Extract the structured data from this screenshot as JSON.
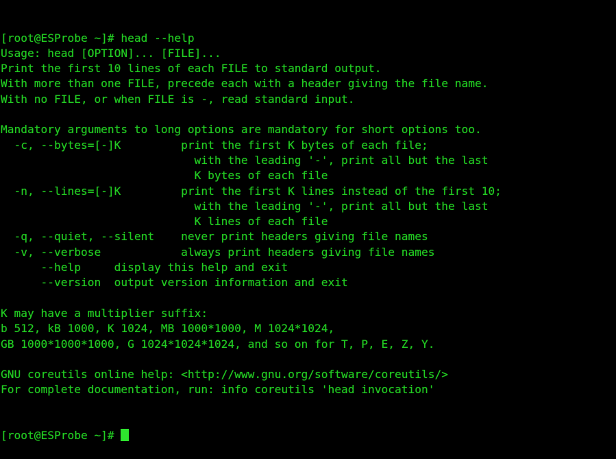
{
  "terminal": {
    "colors": {
      "background": "#000000",
      "foreground": "#22cc22",
      "cursor": "#2ee62e"
    },
    "hostname": "ESProbe",
    "user": "root",
    "cwd": "~",
    "prompt": "[root@ESProbe ~]# ",
    "command": "head --help",
    "cursor_glyph": "block"
  },
  "lines": [
    {
      "id": "prompt-command",
      "text": "[root@ESProbe ~]# head --help"
    },
    {
      "id": "usage",
      "text": "Usage: head [OPTION]... [FILE]..."
    },
    {
      "id": "description-1",
      "text": "Print the first 10 lines of each FILE to standard output."
    },
    {
      "id": "description-2",
      "text": "With more than one FILE, precede each with a header giving the file name."
    },
    {
      "id": "description-3",
      "text": "With no FILE, or when FILE is -, read standard input."
    },
    {
      "id": "blank-1",
      "text": ""
    },
    {
      "id": "mandatory-note",
      "text": "Mandatory arguments to long options are mandatory for short options too."
    },
    {
      "id": "option-bytes",
      "text": "  -c, --bytes=[-]K         print the first K bytes of each file;"
    },
    {
      "id": "option-bytes-cont-1",
      "text": "                             with the leading '-', print all but the last"
    },
    {
      "id": "option-bytes-cont-2",
      "text": "                             K bytes of each file"
    },
    {
      "id": "option-lines",
      "text": "  -n, --lines=[-]K         print the first K lines instead of the first 10;"
    },
    {
      "id": "option-lines-cont-1",
      "text": "                             with the leading '-', print all but the last"
    },
    {
      "id": "option-lines-cont-2",
      "text": "                             K lines of each file"
    },
    {
      "id": "option-quiet",
      "text": "  -q, --quiet, --silent    never print headers giving file names"
    },
    {
      "id": "option-verbose",
      "text": "  -v, --verbose            always print headers giving file names"
    },
    {
      "id": "option-help",
      "text": "      --help     display this help and exit"
    },
    {
      "id": "option-version",
      "text": "      --version  output version information and exit"
    },
    {
      "id": "blank-2",
      "text": ""
    },
    {
      "id": "suffix-intro",
      "text": "K may have a multiplier suffix:"
    },
    {
      "id": "suffix-line-1",
      "text": "b 512, kB 1000, K 1024, MB 1000*1000, M 1024*1024,"
    },
    {
      "id": "suffix-line-2",
      "text": "GB 1000*1000*1000, G 1024*1024*1024, and so on for T, P, E, Z, Y."
    },
    {
      "id": "blank-3",
      "text": ""
    },
    {
      "id": "online-help",
      "text": "GNU coreutils online help: <http://www.gnu.org/software/coreutils/>"
    },
    {
      "id": "documentation",
      "text": "For complete documentation, run: info coreutils 'head invocation'"
    }
  ],
  "final_prompt": {
    "text": "[root@ESProbe ~]# "
  }
}
